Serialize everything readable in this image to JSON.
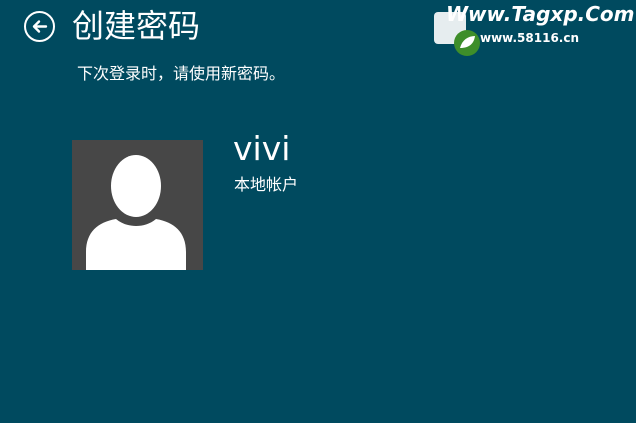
{
  "header": {
    "title": "创建密码",
    "back_icon": "back-arrow-circle-icon"
  },
  "subtitle": "下次登录时，请使用新密码。",
  "account": {
    "name": "vivi",
    "type": "本地帐户",
    "avatar_icon": "user-silhouette-icon"
  },
  "watermark": {
    "site_url": "Www.Tagxp.Com",
    "secondary_url": "www.58116.cn"
  },
  "colors": {
    "background": "#004a5f",
    "avatar_tile": "#474747",
    "foreground": "#ffffff"
  }
}
